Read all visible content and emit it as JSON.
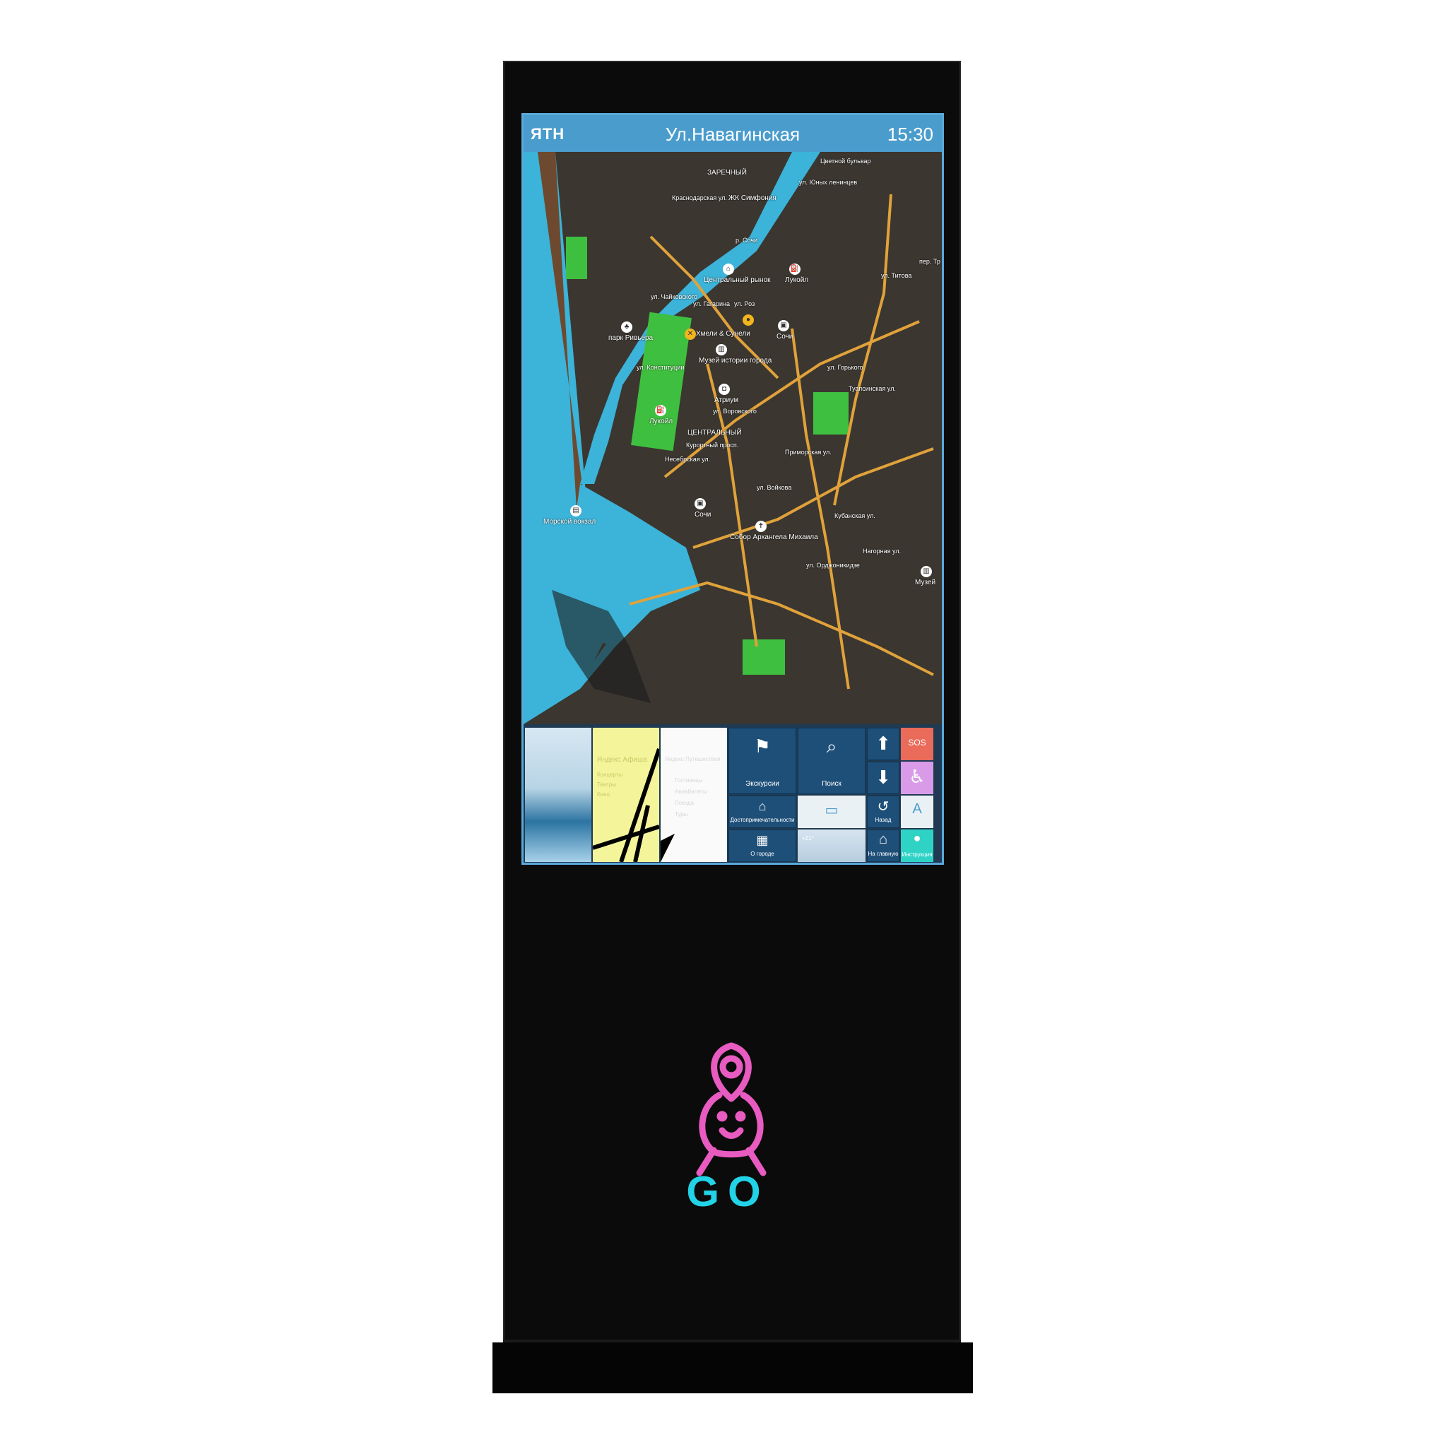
{
  "header": {
    "logo": "ЯТН",
    "title": "Ул.Навагинская",
    "time": "15:30"
  },
  "map": {
    "districts": [
      "ЗАРЕЧНЫЙ",
      "ЦЕНТРАЛЬНЫЙ"
    ],
    "places": [
      "ЖК Симфония",
      "Центральный рынок",
      "Лукойл",
      "парк Ривьера",
      "Хмели & Сунели",
      "Музей истории города",
      "Сочи",
      "Атриум",
      "Лукойл",
      "Морской вокзал",
      "Сочи",
      "Собор Архангела Михаила",
      "Музей"
    ],
    "streets": [
      "Цветной бульвар",
      "ул. Юных ленинцев",
      "Краснодарская ул.",
      "ул. Гагарина",
      "ул. Чайковского",
      "ул. Конституции",
      "ул. Горького",
      "Несебрская ул.",
      "Курортный просп.",
      "ул. Воровского",
      "Туапсинская ул.",
      "ул. Войкова",
      "ул. Орджоникидзе",
      "Кубанская ул.",
      "Нагорная ул.",
      "Приморская ул.",
      "ул. Роз",
      "ул. Титова",
      "р. Сочи",
      "пер. Тр"
    ]
  },
  "tiles": {
    "afisha_title": "Яндекс Афиша",
    "afisha_lines": [
      "Концерты",
      "Театры",
      "Кино"
    ],
    "tourism_title": "Яндекс Путешествия",
    "tourism_lines": [
      "Гостиницы",
      "Авиабилеты",
      "Поезда",
      "Туры"
    ],
    "excursions": "Экскурсии",
    "search": "Поиск",
    "attractions": "Достопримечательности",
    "about_city": "О городе",
    "back": "Назад",
    "home": "На главную",
    "sos": "SOS",
    "instructions": "Инструкция",
    "weather": "+21°"
  },
  "brand": {
    "go_text": "GO",
    "pink": "#e85bc0",
    "cyan": "#22d2e7"
  },
  "icons": {
    "up": "arrow-up-icon",
    "down": "arrow-down-icon",
    "accessibility": "wheelchair-icon",
    "language": "translate-icon"
  }
}
